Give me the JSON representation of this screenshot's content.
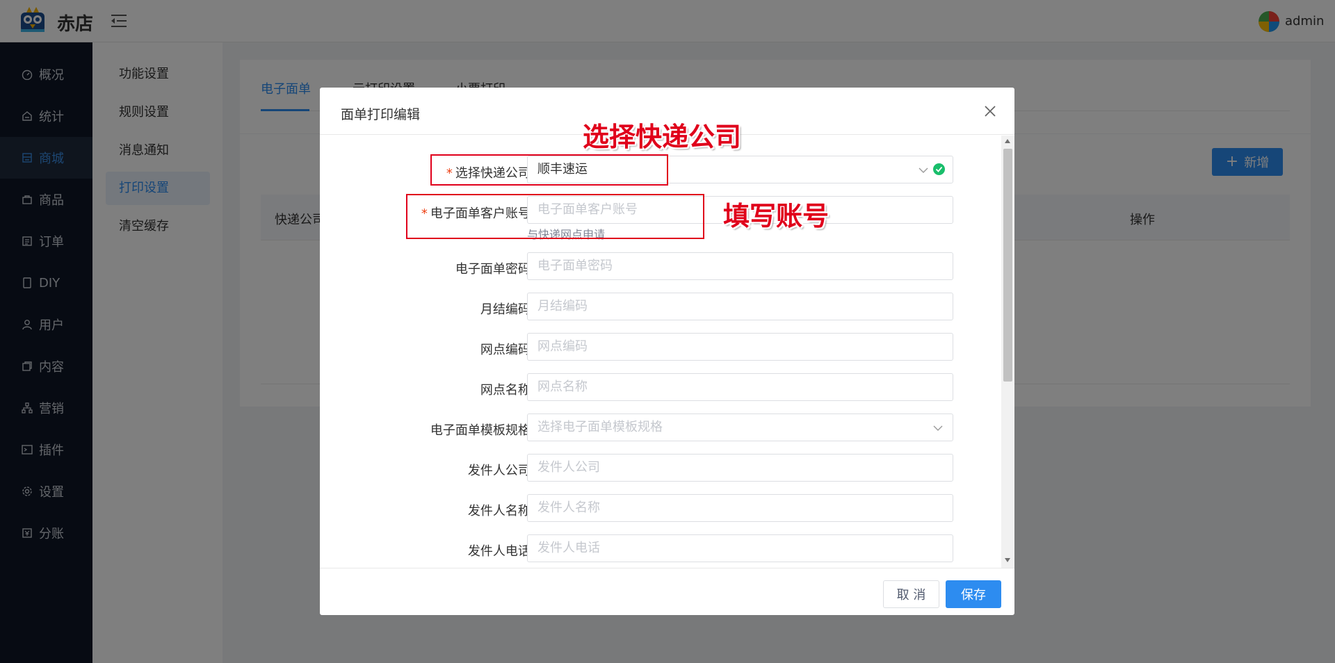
{
  "app": {
    "brand": "赤店",
    "username": "admin"
  },
  "sidebar": {
    "items": [
      {
        "label": "概况",
        "icon": "dashboard-icon"
      },
      {
        "label": "统计",
        "icon": "stats-icon"
      },
      {
        "label": "商城",
        "icon": "store-icon",
        "active": true
      },
      {
        "label": "商品",
        "icon": "bag-icon"
      },
      {
        "label": "订单",
        "icon": "order-icon"
      },
      {
        "label": "DIY",
        "icon": "diy-icon"
      },
      {
        "label": "用户",
        "icon": "user-icon"
      },
      {
        "label": "内容",
        "icon": "content-icon"
      },
      {
        "label": "营销",
        "icon": "marketing-icon"
      },
      {
        "label": "插件",
        "icon": "plugin-icon"
      },
      {
        "label": "设置",
        "icon": "gear-icon"
      },
      {
        "label": "分账",
        "icon": "split-icon"
      }
    ]
  },
  "subnav": {
    "items": [
      {
        "label": "功能设置"
      },
      {
        "label": "规则设置"
      },
      {
        "label": "消息通知"
      },
      {
        "label": "打印设置",
        "active": true
      },
      {
        "label": "清空缓存"
      }
    ]
  },
  "main": {
    "tabs": [
      {
        "label": "电子面单",
        "active": true
      },
      {
        "label": "云打印设置"
      },
      {
        "label": "小票打印"
      }
    ],
    "add_button": "新增",
    "table_headers": [
      "快递公司",
      "操作"
    ]
  },
  "modal": {
    "title": "面单打印编辑",
    "fields": [
      {
        "label": "选择快递公司:",
        "required": true,
        "value": "顺丰速运",
        "type": "select"
      },
      {
        "label": "电子面单客户账号:",
        "required": true,
        "placeholder": "电子面单客户账号",
        "hint": "与快递网点申请"
      },
      {
        "label": "电子面单密码:",
        "placeholder": "电子面单密码"
      },
      {
        "label": "月结编码:",
        "placeholder": "月结编码"
      },
      {
        "label": "网点编码:",
        "placeholder": "网点编码"
      },
      {
        "label": "网点名称:",
        "placeholder": "网点名称"
      },
      {
        "label": "电子面单模板规格:",
        "placeholder": "选择电子面单模板规格",
        "type": "select"
      },
      {
        "label": "发件人公司:",
        "placeholder": "发件人公司"
      },
      {
        "label": "发件人名称:",
        "placeholder": "发件人名称"
      },
      {
        "label": "发件人电话:",
        "placeholder": "发件人电话"
      }
    ],
    "cancel_label": "取 消",
    "save_label": "保存"
  },
  "annotations": {
    "company": "选择快递公司",
    "account": "填写账号"
  },
  "colors": {
    "primary": "#2d8cf0",
    "sidebar": "#0f1726",
    "annotation": "#e0001b",
    "success": "#19be6b"
  }
}
